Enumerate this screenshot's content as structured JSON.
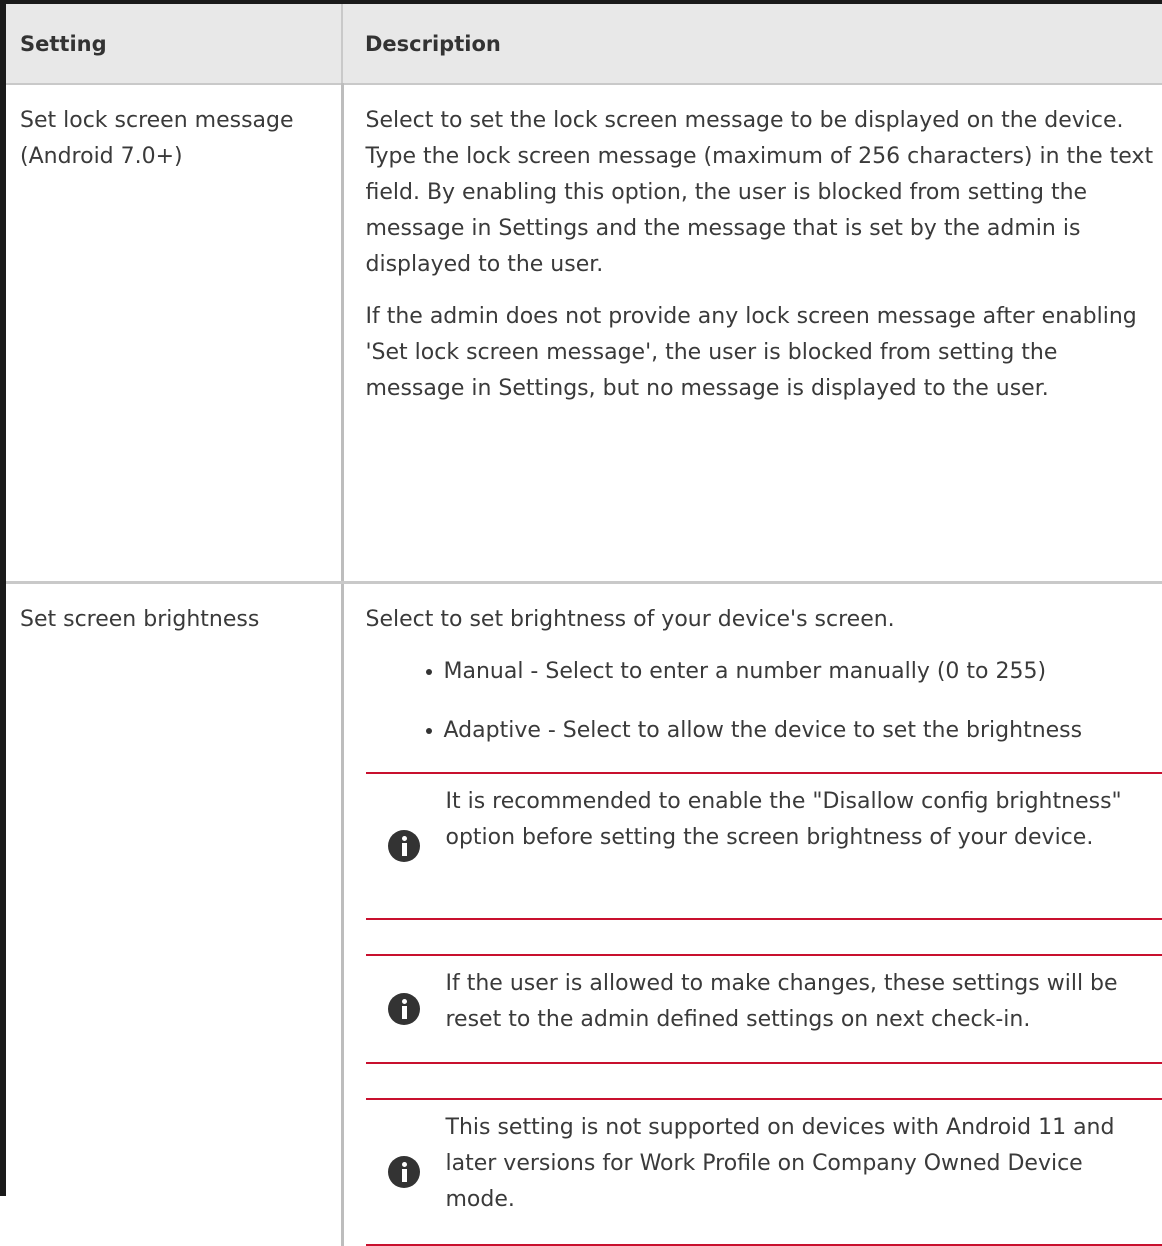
{
  "table": {
    "headers": {
      "setting": "Setting",
      "description": "Description"
    },
    "rows": [
      {
        "setting_line1": "Set lock screen message",
        "setting_line2": "(Android 7.0+)",
        "paragraphs": [
          "Select to set the lock screen message to be displayed on the device. Type the lock screen message (maximum of 256 characters) in the text field. By enabling this option, the user is blocked from setting the message in Settings and the message that is set by the admin is displayed to the user.",
          "If the admin does not provide any lock screen message after enabling 'Set lock screen message', the user is blocked from setting the message in Settings, but no message is displayed to the user."
        ]
      },
      {
        "setting_line1": "Set screen brightness",
        "intro": "Select to set brightness of your device's screen.",
        "options": [
          "Manual - Select to enter a number manually (0 to 255)",
          "Adaptive - Select to allow the device to set the brightness"
        ],
        "notes": [
          "It is recommended to enable the \"Disallow config brightness\" option before setting the screen brightness of your device.",
          "If the user is allowed to make changes, these settings will be reset to the admin defined settings on next check-in.",
          "This setting is not supported on devices with Android 11 and later versions for Work Profile on Company Owned Device mode."
        ]
      }
    ]
  },
  "icons": {
    "note_icon": "info-icon"
  },
  "colors": {
    "note_rule": "#c8102e",
    "header_bg": "#e8e8e8",
    "text": "#333333"
  }
}
